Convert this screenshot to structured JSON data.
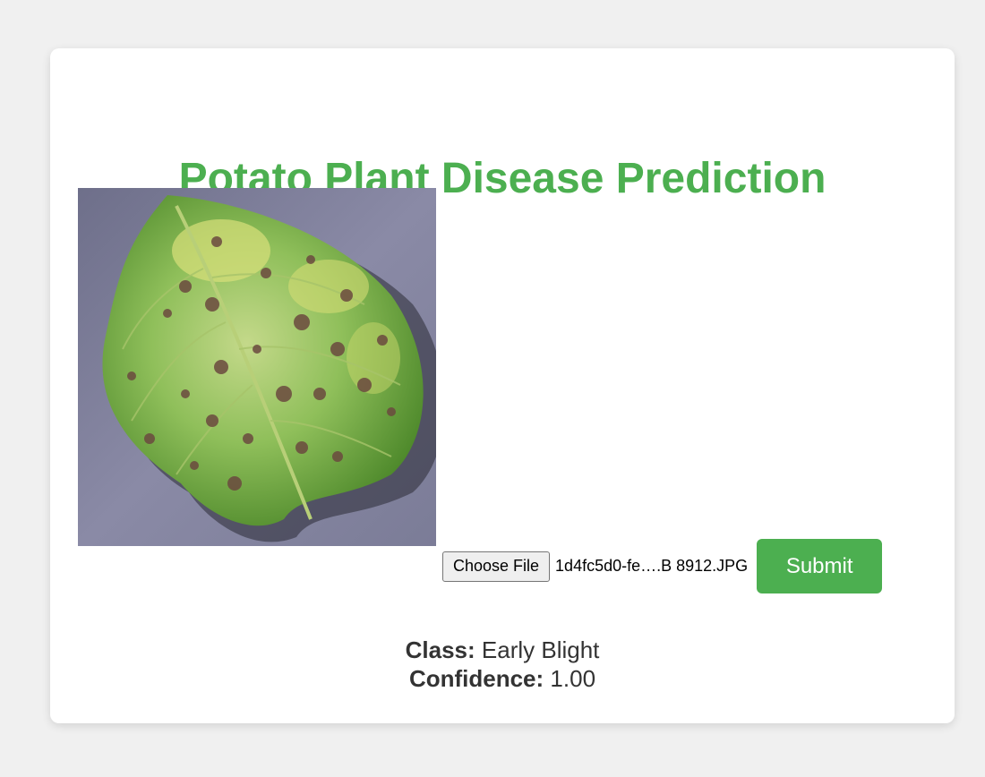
{
  "page": {
    "title": "Potato Plant Disease Prediction",
    "title_color": "#4caf50"
  },
  "image": {
    "subject": "potato leaf with dark spots"
  },
  "upload": {
    "choose_label": "Choose File",
    "file_name": "1d4fc5d0-fe….B 8912.JPG",
    "submit_label": "Submit",
    "submit_color": "#4caf50"
  },
  "result": {
    "class_label": "Class:",
    "class_value": "Early Blight",
    "confidence_label": "Confidence:",
    "confidence_value": "1.00"
  }
}
